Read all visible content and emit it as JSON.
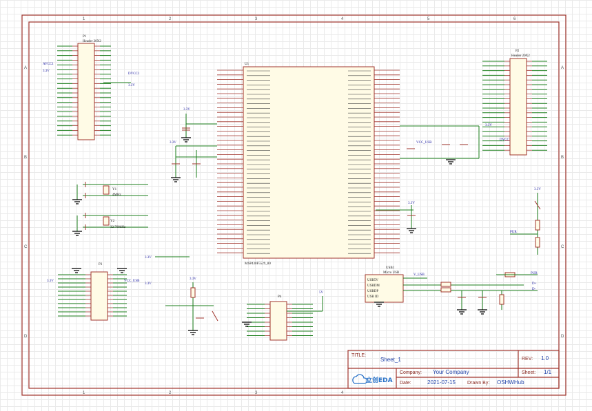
{
  "title_block": {
    "title_label": "TITLE:",
    "title": "Sheet_1",
    "rev_label": "REV:",
    "rev": "1.0",
    "company_label": "Company:",
    "company": "Your Company",
    "sheet_label": "Sheet:",
    "sheet": "1/1",
    "date_label": "Date:",
    "date": "2021-07-15",
    "drawn_label": "Drawn By:",
    "drawn_by": "OSHWHub",
    "logo_text": "立创EDA"
  },
  "border": {
    "columns": [
      "1",
      "2",
      "3",
      "4",
      "5",
      "6"
    ],
    "rows": [
      "A",
      "B",
      "C",
      "D"
    ]
  },
  "components": {
    "p1": {
      "ref": "P1",
      "value": "Header 20X2"
    },
    "p2": {
      "ref": "P2",
      "value": "Header 20X2"
    },
    "p3": {
      "ref": "P3"
    },
    "p4": {
      "ref": "P4"
    },
    "u1": {
      "ref": "U1",
      "part": "MSP430F5529_80"
    },
    "usb": {
      "ref": "USB1",
      "value": "Micro USB"
    },
    "y1": {
      "ref": "Y1",
      "value": "4MHz"
    },
    "y2": {
      "ref": "Y2",
      "value": "32.768kHz"
    }
  },
  "net_labels": {
    "v33": "3.3V",
    "v5": "5V",
    "avcc": "AVCC1",
    "dvcc": "DVCC1",
    "vusb": "V_USB",
    "vcc_usb": "VCC_USB",
    "pur": "PUR",
    "dp": "D+",
    "dm": "D-"
  }
}
